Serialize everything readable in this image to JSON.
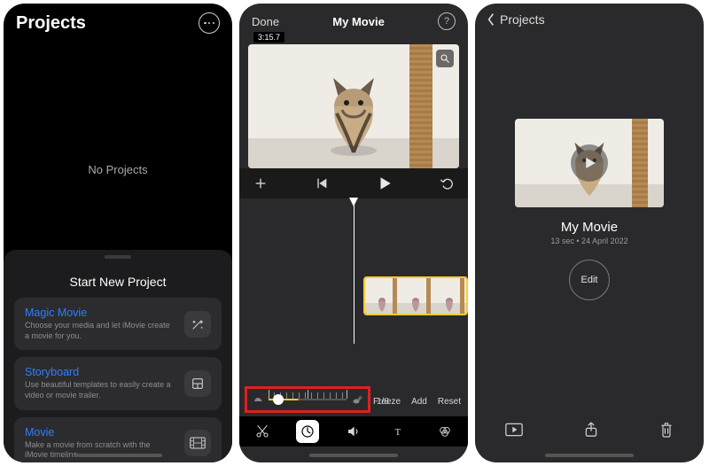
{
  "screen1": {
    "title": "Projects",
    "empty_text": "No Projects",
    "sheet_title": "Start New Project",
    "cards": [
      {
        "name": "Magic Movie",
        "desc": "Choose your media and let iMovie create a movie for you."
      },
      {
        "name": "Storyboard",
        "desc": "Use beautiful templates to easily create a video or movie trailer."
      },
      {
        "name": "Movie",
        "desc": "Make a movie from scratch with the iMovie timeline."
      }
    ]
  },
  "screen2": {
    "done": "Done",
    "title": "My Movie",
    "clip_time": "3:15.7",
    "speed_value": "1/8",
    "clip_badge": "T",
    "commands": {
      "freeze": "Freeze",
      "add": "Add",
      "reset": "Reset"
    }
  },
  "screen3": {
    "back": "Projects",
    "name": "My Movie",
    "meta": "13 sec • 24 April 2022",
    "edit": "Edit"
  }
}
